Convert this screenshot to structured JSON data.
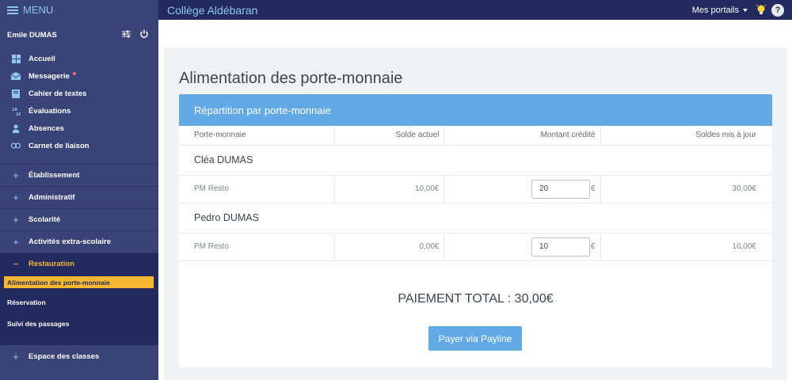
{
  "topbar": {
    "menu_label": "MENU",
    "site_title": "Collège Aldébaran",
    "portals_label": "Mes portails",
    "help_label": "?"
  },
  "sidebar": {
    "user_name": "Emile DUMAS",
    "items": [
      {
        "label": "Accueil",
        "icon": "grid-icon"
      },
      {
        "label": "Messagerie",
        "icon": "envelope-icon"
      },
      {
        "label": "Cahier de textes",
        "icon": "book-icon"
      },
      {
        "label": "Évaluations",
        "icon": "grades-icon"
      },
      {
        "label": "Absences",
        "icon": "person-icon"
      },
      {
        "label": "Carnet de liaison",
        "icon": "link-icon"
      }
    ],
    "sections": [
      {
        "label": "Établissement"
      },
      {
        "label": "Administratif"
      },
      {
        "label": "Scolarité"
      },
      {
        "label": "Activités extra-scolaire"
      },
      {
        "label": "Restauration",
        "open": true
      },
      {
        "label": "Espace des classes"
      }
    ],
    "restauration_sub": [
      {
        "label": "Alimentation des porte-monnaie",
        "active": true
      },
      {
        "label": "Réservation"
      },
      {
        "label": "Suivi des passages"
      }
    ],
    "open_marker": "−",
    "closed_marker": "+"
  },
  "main": {
    "title": "Alimentation des porte-monnaie",
    "card_title": "Répartition par porte-monnaie",
    "columns": [
      "Porte-monnaie",
      "Solde actuel",
      "Montant crédité",
      "Soldes mis à jour"
    ],
    "students": [
      {
        "name": "Cléa DUMAS",
        "wallet": {
          "name": "PM Resto",
          "current": "10,00€",
          "credited": "20",
          "currency": "€",
          "updated": "30,00€"
        }
      },
      {
        "name": "Pedro DUMAS",
        "wallet": {
          "name": "PM Resto",
          "current": "0,00€",
          "credited": "10",
          "currency": "€",
          "updated": "10,00€"
        }
      }
    ],
    "total": "PAIEMENT TOTAL : 30,00€",
    "pay_button": "Payer via Payline"
  },
  "colors": {
    "topbar": "#232a5e",
    "sidebar": "#3a4377",
    "accent": "#62a9e6",
    "active": "#f7b731"
  }
}
